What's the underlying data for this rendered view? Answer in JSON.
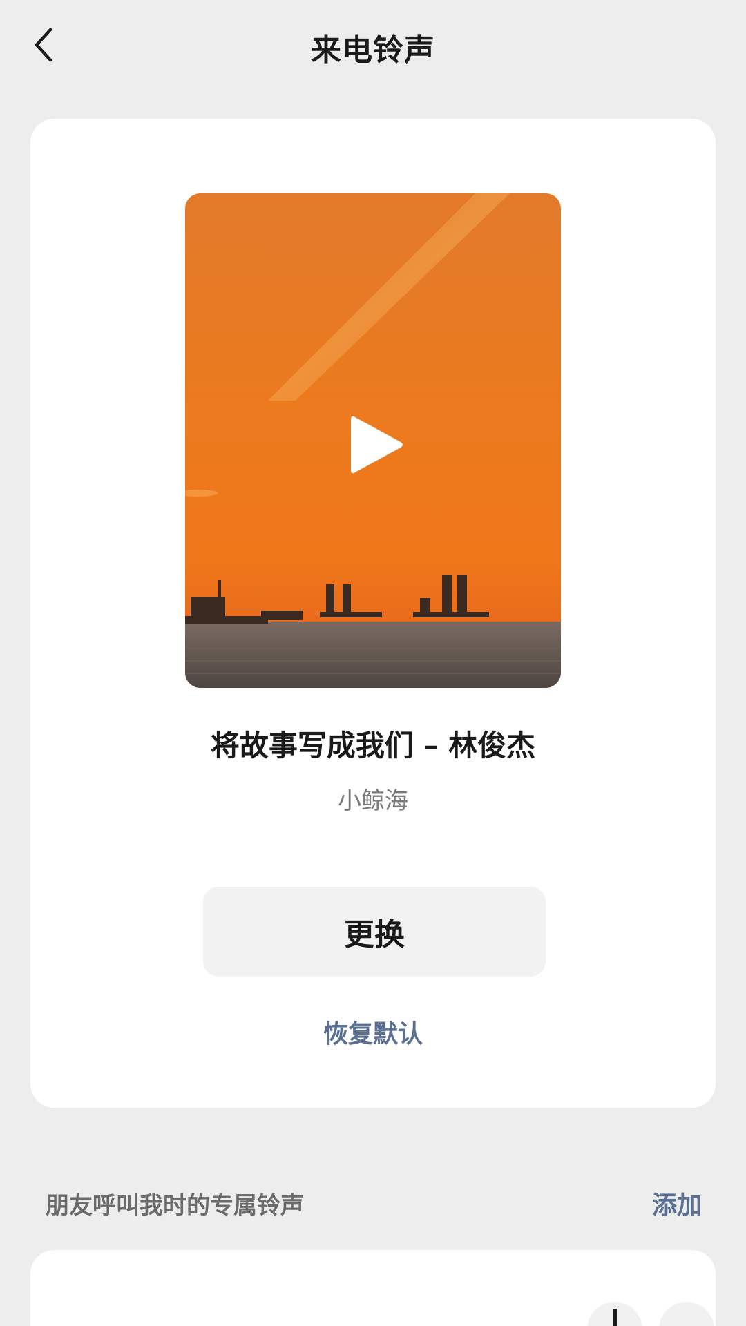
{
  "header": {
    "title": "来电铃声",
    "back_icon": "chevron-left-icon"
  },
  "ringtone": {
    "song_title": "将故事写成我们 – 林俊杰",
    "subtitle": "小鲸海",
    "change_label": "更换",
    "restore_label": "恢复默认",
    "play_icon": "play-icon"
  },
  "friends_section": {
    "title": "朋友呼叫我时的专属铃声",
    "add_label": "添加"
  },
  "colors": {
    "background": "#ededed",
    "card": "#ffffff",
    "accent_link": "#5a6f92",
    "sunset_orange": "#e8721c"
  }
}
